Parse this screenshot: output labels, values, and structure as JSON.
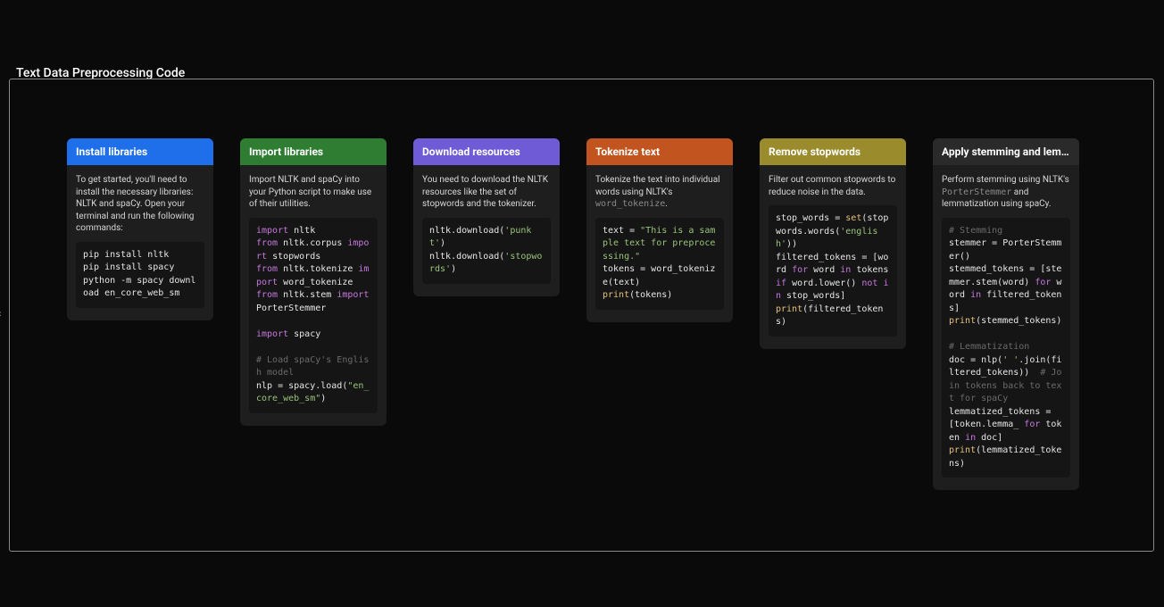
{
  "page_title": "Text Data Preprocessing Code",
  "cards": [
    {
      "id": "install",
      "title": "Install libraries",
      "header_class": "hc-blue",
      "desc_plain": "To get started, you'll need to install the necessary libraries: NLTK and spaCy. Open your terminal and run the following commands:",
      "code_plain": "pip install nltk\npip install spacy\npython -m spacy download en_core_web_sm"
    },
    {
      "id": "import",
      "title": "Import libraries",
      "header_class": "hc-green",
      "desc_plain": "Import NLTK and spaCy into your Python script to make use of their utilities.",
      "code_html": "<span class=\"tok-k\">import</span> nltk\n<span class=\"tok-k\">from</span> nltk.corpus <span class=\"tok-k\">import</span> stopwords\n<span class=\"tok-k\">from</span> nltk.tokenize <span class=\"tok-k\">import</span> word_tokenize\n<span class=\"tok-k\">from</span> nltk.stem <span class=\"tok-k\">import</span> PorterStemmer\n\n<span class=\"tok-k\">import</span> spacy\n\n<span class=\"tok-c\"># Load spaCy's English model</span>\nnlp = spacy.load(<span class=\"tok-s\">\"en_core_web_sm\"</span>)"
    },
    {
      "id": "download",
      "title": "Download resources",
      "header_class": "hc-purple",
      "desc_plain": "You need to download the NLTK resources like the set of stopwords and the tokenizer.",
      "code_html": "nltk.download(<span class=\"tok-s\">'punkt'</span>)\nnltk.download(<span class=\"tok-s\">'stopwords'</span>)"
    },
    {
      "id": "tokenize",
      "title": "Tokenize text",
      "header_class": "hc-orange",
      "desc_html": "Tokenize the text into individual words using NLTK's <span class=\"inline-code\">word_tokenize</span>.",
      "code_html": "text = <span class=\"tok-s\">\"This is a sample text for preprocessing.\"</span>\ntokens = word_tokenize(text)\n<span class=\"tok-f\">print</span>(tokens)"
    },
    {
      "id": "stopwords",
      "title": "Remove stopwords",
      "header_class": "hc-olive",
      "desc_plain": "Filter out common stopwords to reduce noise in the data.",
      "code_html": "stop_words = <span class=\"tok-f\">set</span>(stopwords.words(<span class=\"tok-s\">'english'</span>))\nfiltered_tokens = [word <span class=\"tok-k\">for</span> word <span class=\"tok-k\">in</span> tokens <span class=\"tok-k\">if</span> word.lower() <span class=\"tok-k\">not</span> <span class=\"tok-k\">in</span> stop_words]\n<span class=\"tok-f\">print</span>(filtered_tokens)"
    },
    {
      "id": "stemlemma",
      "title": "Apply stemming and lem…",
      "header_class": "hc-dark",
      "desc_html": "Perform stemming using NLTK's <span class=\"inline-code\">PorterStemmer</span> and lemmatization using spaCy.",
      "code_html": "<span class=\"tok-c\"># Stemming</span>\nstemmer = PorterStemmer()\nstemmed_tokens = [stemmer.stem(word) <span class=\"tok-k\">for</span> word <span class=\"tok-k\">in</span> filtered_tokens]\n<span class=\"tok-f\">print</span>(stemmed_tokens)\n\n<span class=\"tok-c\"># Lemmatization</span>\ndoc = nlp(<span class=\"tok-s\">' '</span>.join(filtered_tokens))  <span class=\"tok-c\"># Join tokens back to text for spaCy</span>\nlemmatized_tokens = [token.lemma_ <span class=\"tok-k\">for</span> token <span class=\"tok-k\">in</span> doc]\n<span class=\"tok-f\">print</span>(lemmatized_tokens)"
    }
  ]
}
